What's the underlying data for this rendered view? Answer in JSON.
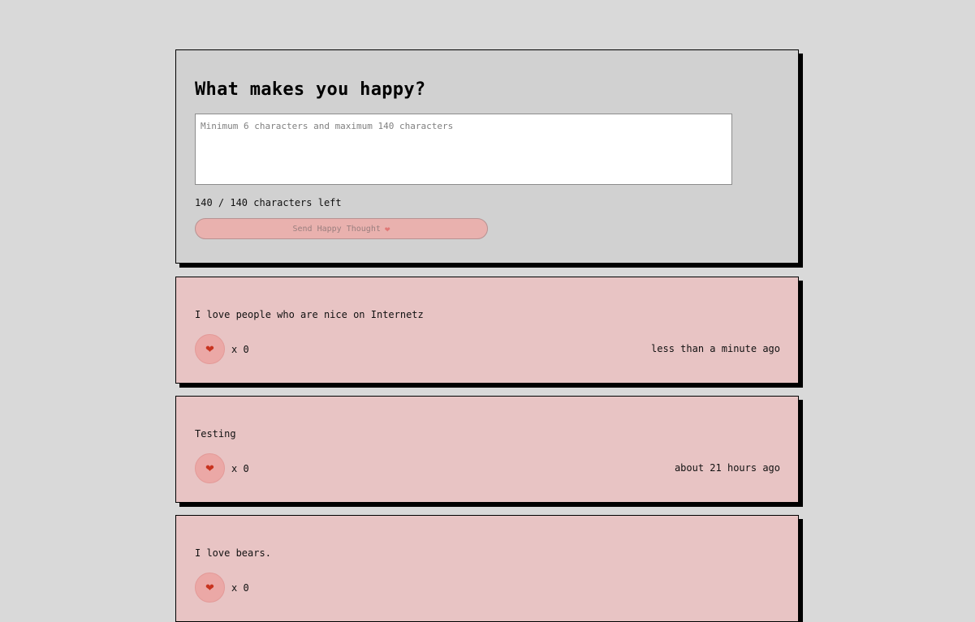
{
  "form": {
    "title": "What makes you happy?",
    "input_value": "",
    "input_placeholder": "Minimum 6 characters and maximum 140 characters",
    "counter_text": "140 / 140 characters left",
    "send_label": "Send Happy Thought",
    "send_icon": "heart-icon"
  },
  "thoughts": [
    {
      "message": "I love people who are nice on Internetz",
      "likes": "x 0",
      "time": "less than a minute ago"
    },
    {
      "message": "Testing",
      "likes": "x 0",
      "time": "about 21 hours ago"
    },
    {
      "message": "I love bears.",
      "likes": "x 0",
      "time": ""
    }
  ],
  "colors": {
    "page_background": "#d9d9d9",
    "form_background": "#d1d1d1",
    "thought_background": "#e8c4c4",
    "button_background": "#e9b1ae",
    "like_button_background": "#eba8a6",
    "heart": "#c8331f"
  }
}
